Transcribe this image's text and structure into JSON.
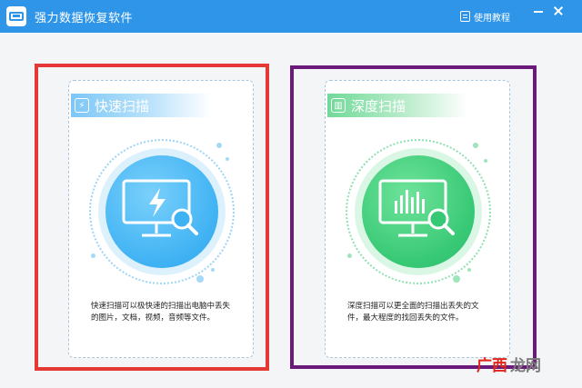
{
  "app": {
    "title": "强力数据恢复软件",
    "tutorial_label": "使用教程",
    "icons": {
      "app": "hard-drive-icon",
      "tutorial": "book-icon",
      "minimize": "minimize-icon",
      "close": "close-icon"
    }
  },
  "cards": [
    {
      "id": "quick",
      "title": "快速扫描",
      "description": "快速扫描可以极快速的扫描出电脑中丢失的图片，文档，视频，音频等文件。",
      "icon": "lightning-monitor-search-icon",
      "accent": "#3fb2f3"
    },
    {
      "id": "deep",
      "title": "深度扫描",
      "description": "深度扫描可以更全面的扫描出丢失的文件，最大程度的找回丢失的文件。",
      "icon": "chart-monitor-search-icon",
      "accent": "#36c874"
    }
  ],
  "highlights": {
    "quick_color": "#e53935",
    "deep_color": "#6a1b7a"
  },
  "watermark": {
    "part1": "广西",
    "part2": "龙网"
  }
}
